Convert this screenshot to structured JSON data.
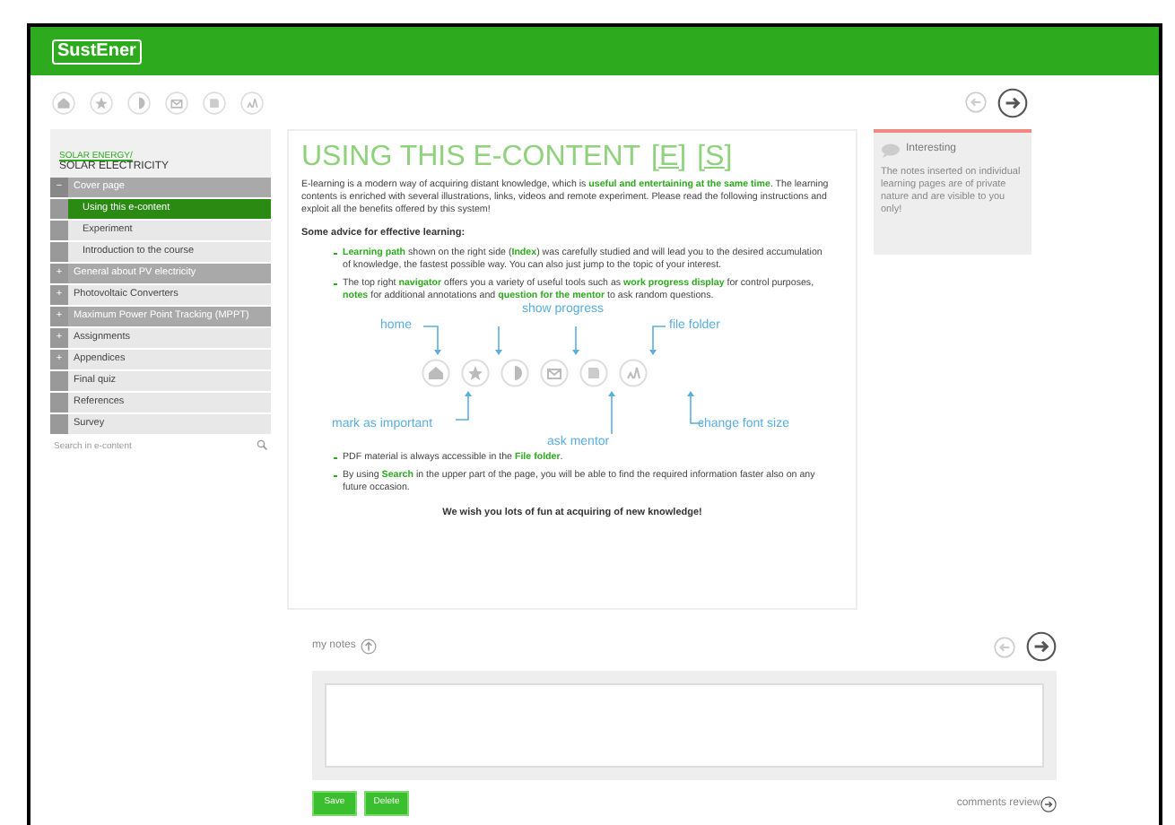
{
  "header": {
    "logo": "SustEner"
  },
  "toolbar": {
    "icons": [
      {
        "kind": "home"
      },
      {
        "kind": "star"
      },
      {
        "kind": "progress"
      },
      {
        "kind": "mentor"
      },
      {
        "kind": "folder"
      },
      {
        "kind": "font"
      }
    ],
    "back_disabled": true
  },
  "sidebar": {
    "breadcrumb": "SOLAR ENERGY/",
    "course": "SOLAR ELECTRICITY",
    "items": [
      {
        "label": "Cover page",
        "toggle": "−",
        "expanded": true,
        "disabled": true,
        "children": [
          {
            "label": "Using this e-content",
            "selected": true
          },
          {
            "label": "Experiment",
            "selected": false
          },
          {
            "label": "Introduction to the course",
            "selected": false
          }
        ]
      },
      {
        "label": "General about PV electricity",
        "toggle": "+",
        "disabled": true
      },
      {
        "label": "Photovoltaic Converters",
        "toggle": "+",
        "disabled": false
      },
      {
        "label": "Maximum Power Point Tracking (MPPT)",
        "toggle": "+",
        "disabled": true
      },
      {
        "label": "Assignments",
        "toggle": "+",
        "disabled": false
      },
      {
        "label": "Appendices",
        "toggle": "+",
        "disabled": false
      },
      {
        "label": "Final quiz",
        "disabled": false
      },
      {
        "label": "References",
        "disabled": false
      },
      {
        "label": "Survey",
        "disabled": false
      }
    ],
    "search": {
      "placeholder": "Search in e-content"
    }
  },
  "content": {
    "title": "USING THIS E-CONTENT",
    "language_links": [
      "[E]",
      "[S]"
    ],
    "intro": "E-learning is a modern way of acquiring distant knowledge, which is **useful and entertaining at the same time**. The learning contents is enriched with several illustrations, links, videos and remote experiment. Please read the following instructions and exploit all the benefits offered by this system!",
    "advice_heading": "Some advice for effective learning:",
    "bullets": [
      "**Learning path** shown on the right side (**Index**) was carefully studied and will lead you to the desired accumulation of knowledge, the fastest possible way. You can also just jump to the topic of your interest.",
      "The top right **navigator** offers you a variety of useful tools such as **work progress display** for control purposes, **notes** for additional annotations and **question for the mentor** to ask random questions."
    ],
    "diagram_labels": {
      "home": "home",
      "show_progress": "show progress",
      "file_folder": "file folder",
      "mark_important": "mark as important",
      "ask_mentor": "ask mentor",
      "font_size": "change font size"
    },
    "bullets_2": [
      "PDF material is always accessible in the **File folder**.",
      "By using **Search** in the upper part of the page, you will be able to find the required information faster also on any future occasion."
    ],
    "closing": "We wish you lots of fun at acquiring of new knowledge!"
  },
  "info_panel": {
    "title": "Interesting",
    "text": "The notes inserted on individual learning pages are of private nature and are visible to you only!"
  },
  "notes": {
    "label": "my notes",
    "buttons": [
      "Save",
      "Delete"
    ],
    "comments_link": "comments review"
  }
}
